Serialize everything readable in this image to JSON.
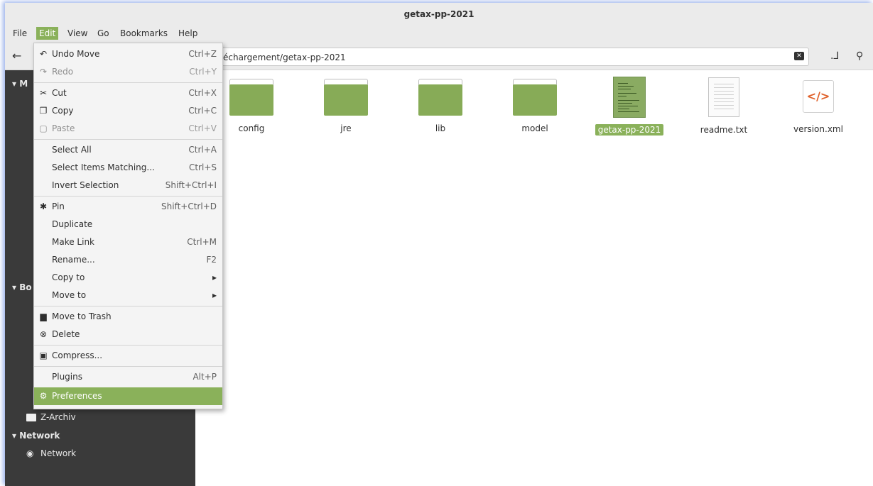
{
  "window": {
    "title": "getax-pp-2021"
  },
  "menubar": [
    {
      "label": "File",
      "active": false
    },
    {
      "label": "Edit",
      "active": true
    },
    {
      "label": "View",
      "active": false
    },
    {
      "label": "Go",
      "active": false
    },
    {
      "label": "Bookmarks",
      "active": false
    },
    {
      "label": "Help",
      "active": false
    }
  ],
  "location": {
    "visible_path": "échargement/getax-pp-2021"
  },
  "edit_menu": [
    {
      "label": "Undo Move",
      "accel": "Ctrl+Z",
      "icon": "undo-icon",
      "disabled": false
    },
    {
      "label": "Redo",
      "accel": "Ctrl+Y",
      "icon": "redo-icon",
      "disabled": true
    },
    {
      "label": "Cut",
      "accel": "Ctrl+X",
      "icon": "scissors-icon",
      "disabled": false
    },
    {
      "label": "Copy",
      "accel": "Ctrl+C",
      "icon": "copy-icon",
      "disabled": false
    },
    {
      "label": "Paste",
      "accel": "Ctrl+V",
      "icon": "clipboard-icon",
      "disabled": true
    },
    {
      "label": "Select All",
      "accel": "Ctrl+A",
      "disabled": false
    },
    {
      "label": "Select Items Matching...",
      "accel": "Ctrl+S",
      "disabled": false
    },
    {
      "label": "Invert Selection",
      "accel": "Shift+Ctrl+I",
      "disabled": false
    },
    {
      "label": "Pin",
      "accel": "Shift+Ctrl+D",
      "icon": "pin-icon",
      "disabled": false
    },
    {
      "label": "Duplicate",
      "accel": "",
      "disabled": false
    },
    {
      "label": "Make Link",
      "accel": "Ctrl+M",
      "disabled": false
    },
    {
      "label": "Rename...",
      "accel": "F2",
      "disabled": false
    },
    {
      "label": "Copy to",
      "accel": "▸",
      "disabled": false
    },
    {
      "label": "Move to",
      "accel": "▸",
      "disabled": false
    },
    {
      "label": "Move to Trash",
      "accel": "",
      "icon": "trash-icon",
      "disabled": false
    },
    {
      "label": "Delete",
      "accel": "",
      "icon": "delete-icon",
      "disabled": false
    },
    {
      "label": "Compress...",
      "accel": "",
      "icon": "archive-icon",
      "disabled": false
    },
    {
      "label": "Plugins",
      "accel": "Alt+P",
      "disabled": false
    },
    {
      "label": "Preferences",
      "accel": "",
      "icon": "preferences-icon",
      "disabled": false,
      "highlighted": true
    }
  ],
  "sidebar": {
    "head_my": "M",
    "head_bookmarks": "Bo",
    "archive_label": "Z-Archiv",
    "network_head": "Network",
    "network_item": "Network"
  },
  "files": [
    {
      "name": "config",
      "type": "folder"
    },
    {
      "name": "jre",
      "type": "folder"
    },
    {
      "name": "lib",
      "type": "folder"
    },
    {
      "name": "model",
      "type": "folder"
    },
    {
      "name": "getax-pp-2021",
      "type": "executable",
      "selected": true
    },
    {
      "name": "readme.txt",
      "type": "text"
    },
    {
      "name": "version.xml",
      "type": "xml"
    }
  ],
  "colors": {
    "accent": "#8ab15a",
    "folder": "#87ab57",
    "sidebar": "#3a3a3a"
  }
}
